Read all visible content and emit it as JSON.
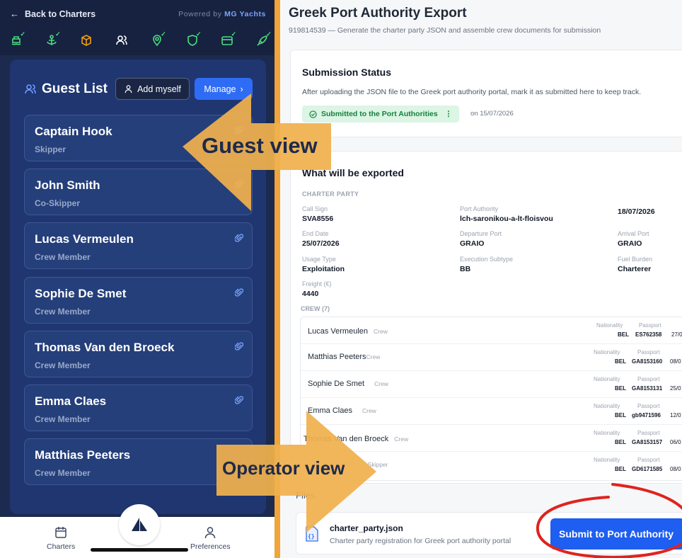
{
  "guest_app": {
    "back_label": "Back to Charters",
    "powered_prefix": "Powered by",
    "powered_brand": "MG Yachts",
    "nav_icons": [
      "boat-icon",
      "anchor-icon",
      "package-icon",
      "users-icon",
      "map-pin-icon",
      "shield-icon",
      "wallet-icon",
      "rocket-icon"
    ],
    "title": "Guest List",
    "add_myself_label": "Add myself",
    "manage_label": "Manage",
    "guests": [
      {
        "name": "Captain Hook",
        "role": "Skipper"
      },
      {
        "name": "John Smith",
        "role": "Co-Skipper"
      },
      {
        "name": "Lucas Vermeulen",
        "role": "Crew Member"
      },
      {
        "name": "Sophie De Smet",
        "role": "Crew Member"
      },
      {
        "name": "Thomas Van den Broeck",
        "role": "Crew Member"
      },
      {
        "name": "Emma Claes",
        "role": "Crew Member"
      },
      {
        "name": "Matthias Peeters",
        "role": "Crew Member"
      }
    ],
    "bottom_nav": {
      "charters": "Charters",
      "preferences": "Preferences"
    }
  },
  "operator_app": {
    "title": "Greek Port Authority Export",
    "subtitle": "919814539 — Generate the charter party JSON and assemble crew documents for submission",
    "submission": {
      "title": "Submission Status",
      "text": "After uploading the JSON file to the Greek port authority portal, mark it as submitted here to keep track.",
      "badge": "Submitted to the Port Authorities",
      "date": "on 15/07/2026"
    },
    "export": {
      "title": "What will be exported",
      "charter_party_label": "CHARTER PARTY",
      "fields": [
        {
          "label": "Call Sign",
          "value": "SVA8556"
        },
        {
          "label": "Port Authority",
          "value": "lch-saronikou-a-lt-floisvou"
        },
        {
          "label": "",
          "value": "18/07/2026"
        },
        {
          "label": "End Date",
          "value": "25/07/2026"
        },
        {
          "label": "Departure Port",
          "value": "GRAIO"
        },
        {
          "label": "Arrival Port",
          "value": "GRAIO"
        },
        {
          "label": "Usage Type",
          "value": "Exploitation"
        },
        {
          "label": "Execution Subtype",
          "value": "BB"
        },
        {
          "label": "Fuel Burden",
          "value": "Charterer"
        },
        {
          "label": "Freight (€)",
          "value": "4440"
        }
      ],
      "crew_label": "CREW (7)",
      "crew_col_nationality": "Nationality",
      "crew_col_passport": "Passport",
      "crew": [
        {
          "name": "Lucas Vermeulen",
          "role": "Crew",
          "nationality": "BEL",
          "passport": "ES762358",
          "date": "27/0"
        },
        {
          "name": "Matthias Peeters",
          "role": "Crew",
          "nationality": "BEL",
          "passport": "GA8153160",
          "date": "08/0"
        },
        {
          "name": "Sophie De Smet",
          "role": "Crew",
          "nationality": "BEL",
          "passport": "GA8153131",
          "date": "25/0"
        },
        {
          "name": "Emma Claes",
          "role": "Crew",
          "nationality": "BEL",
          "passport": "gb9471596",
          "date": "12/0"
        },
        {
          "name": "Thomas Van den Broeck",
          "role": "Crew",
          "nationality": "BEL",
          "passport": "GA8153157",
          "date": "06/0"
        },
        {
          "name": "Captain Hook",
          "role": "Skipper",
          "nationality": "BEL",
          "passport": "GD6171585",
          "date": "08/0"
        }
      ]
    },
    "files": {
      "title": "Files",
      "name": "charter_party.json",
      "description": "Charter party registration for Greek port authority portal"
    },
    "submit_label": "Submit to Port Authority"
  },
  "annotations": {
    "guest_view": "Guest view",
    "operator_view": "Operator view",
    "arrow_color": "#f0b04e",
    "highlight_color": "#e0231d"
  },
  "colors": {
    "accent": "#2f6cf5",
    "navy": "#1b2a4e",
    "success": "#15803d"
  }
}
